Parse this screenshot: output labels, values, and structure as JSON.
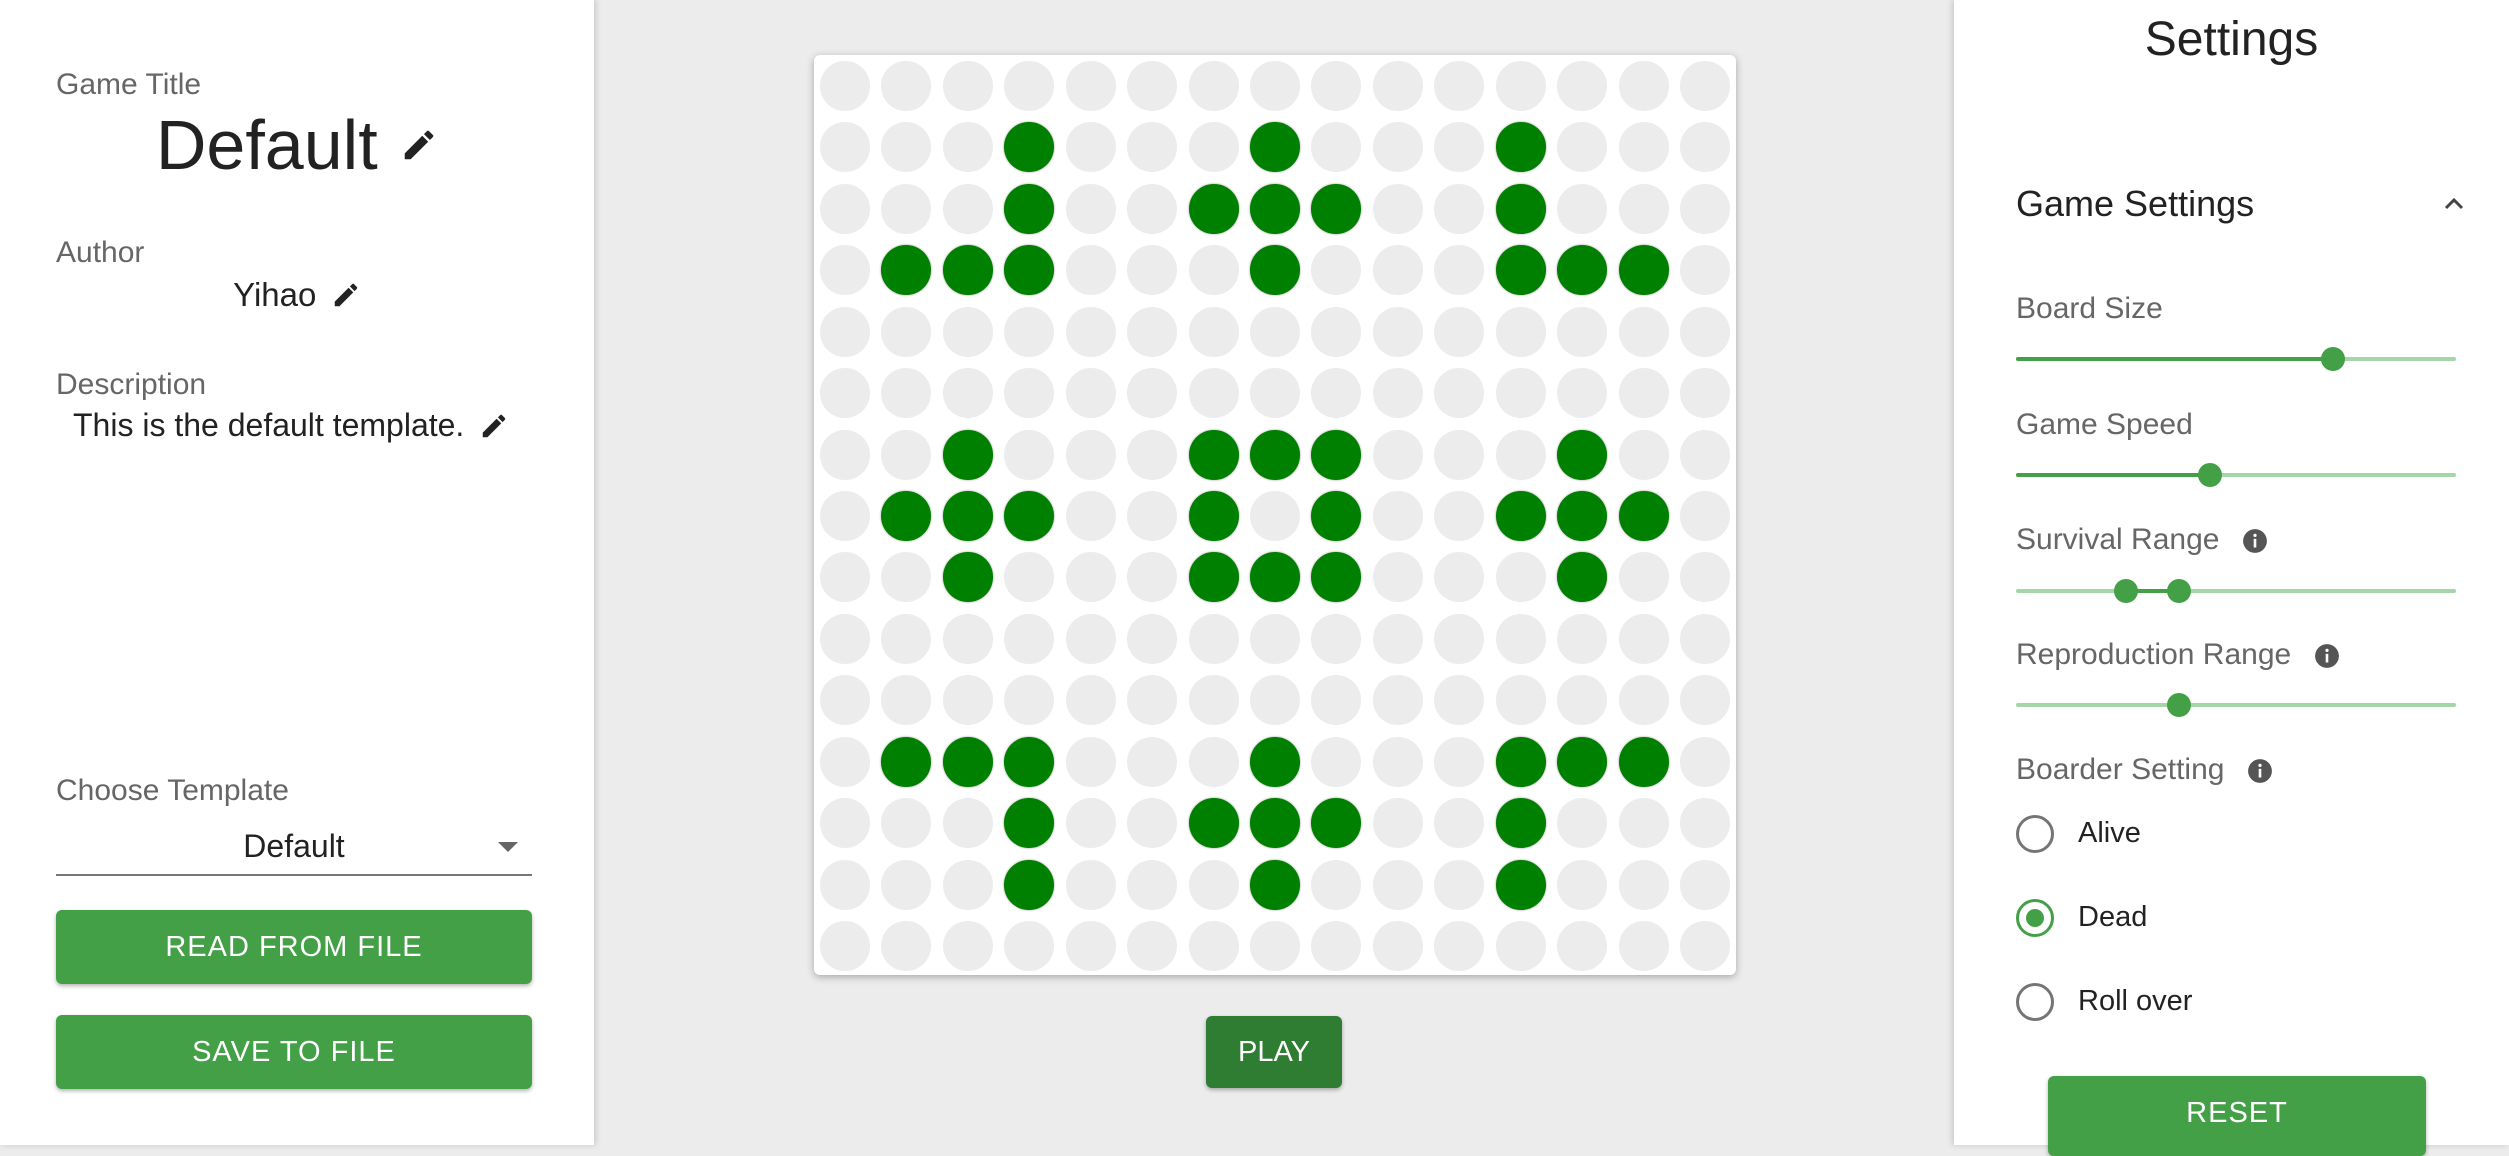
{
  "left_panel": {
    "game_title_label": "Game Title",
    "game_title": "Default",
    "author_label": "Author",
    "author": "Yihao",
    "description_label": "Description",
    "description": "This is the default template.",
    "template_label": "Choose Template",
    "template_value": "Default",
    "read_button": "READ FROM FILE",
    "save_button": "SAVE TO FILE"
  },
  "board": {
    "rows": 15,
    "cols": 15,
    "alive_color": "#008000",
    "dead_color": "#ececec",
    "alive_cells": [
      [
        1,
        3
      ],
      [
        1,
        7
      ],
      [
        1,
        11
      ],
      [
        2,
        3
      ],
      [
        2,
        6
      ],
      [
        2,
        7
      ],
      [
        2,
        8
      ],
      [
        2,
        11
      ],
      [
        3,
        1
      ],
      [
        3,
        2
      ],
      [
        3,
        3
      ],
      [
        3,
        7
      ],
      [
        3,
        11
      ],
      [
        3,
        12
      ],
      [
        3,
        13
      ],
      [
        6,
        2
      ],
      [
        6,
        6
      ],
      [
        6,
        7
      ],
      [
        6,
        8
      ],
      [
        6,
        12
      ],
      [
        7,
        1
      ],
      [
        7,
        2
      ],
      [
        7,
        3
      ],
      [
        7,
        6
      ],
      [
        7,
        8
      ],
      [
        7,
        11
      ],
      [
        7,
        12
      ],
      [
        7,
        13
      ],
      [
        8,
        2
      ],
      [
        8,
        6
      ],
      [
        8,
        7
      ],
      [
        8,
        8
      ],
      [
        8,
        12
      ],
      [
        11,
        1
      ],
      [
        11,
        2
      ],
      [
        11,
        3
      ],
      [
        11,
        7
      ],
      [
        11,
        11
      ],
      [
        11,
        12
      ],
      [
        11,
        13
      ],
      [
        12,
        3
      ],
      [
        12,
        6
      ],
      [
        12,
        7
      ],
      [
        12,
        8
      ],
      [
        12,
        11
      ],
      [
        13,
        3
      ],
      [
        13,
        7
      ],
      [
        13,
        11
      ]
    ]
  },
  "play_button": "PLAY",
  "settings": {
    "title": "Settings",
    "section_title": "Game Settings",
    "accent_color": "#43a047",
    "board_size": {
      "label": "Board Size",
      "value": 0.72
    },
    "game_speed": {
      "label": "Game Speed",
      "value": 0.44
    },
    "survival_range": {
      "label": "Survival Range",
      "low": 0.25,
      "high": 0.37
    },
    "reproduction_range": {
      "label": "Reproduction Range",
      "value": 0.37
    },
    "border_setting": {
      "label": "Boarder Setting",
      "options": [
        "Alive",
        "Dead",
        "Roll over"
      ],
      "selected": "Dead"
    },
    "reset_button": "RESET"
  }
}
